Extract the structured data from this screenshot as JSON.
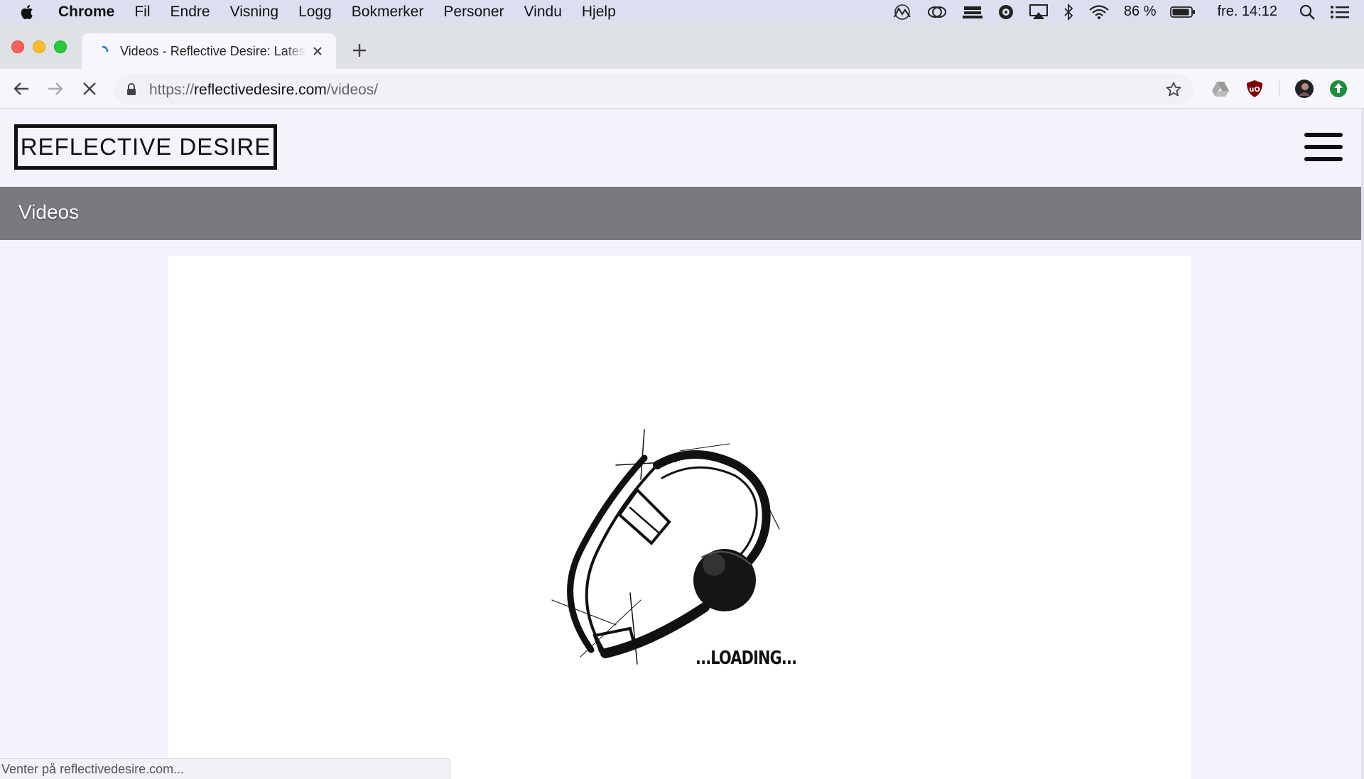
{
  "menubar": {
    "app_name": "Chrome",
    "items": [
      "Fil",
      "Endre",
      "Visning",
      "Logg",
      "Bokmerker",
      "Personer",
      "Vindu",
      "Hjelp"
    ],
    "battery": "86 %",
    "clock": "fre. 14:12",
    "status_icons": [
      "creative-cloud-icon",
      "cc-sync-icon",
      "dock-icon",
      "disk-icon",
      "airplay-icon",
      "bluetooth-icon",
      "wifi-icon",
      "battery-icon"
    ]
  },
  "tab": {
    "title": "Videos - Reflective Desire: Latest"
  },
  "toolbar": {
    "url_scheme": "https://",
    "url_host": "reflectivedesire.com",
    "url_path": "/videos/"
  },
  "site": {
    "logo_text": "REFLECTIVE DESIRE",
    "page_title": "Videos",
    "loading_text": "...LOADING..."
  },
  "status_bar": {
    "text": "Venter på reflectivedesire.com..."
  },
  "colors": {
    "title_bar": "#79797e",
    "menubar": "#dcdff0",
    "page_bg": "#f3f4fb"
  }
}
